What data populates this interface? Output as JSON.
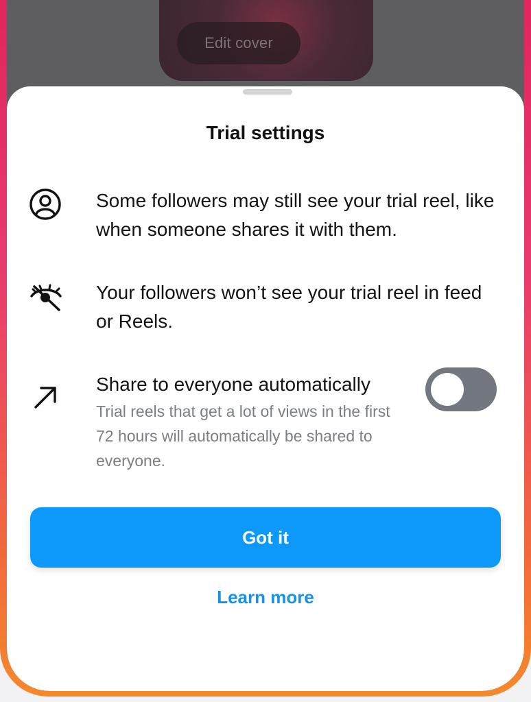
{
  "background": {
    "edit_cover_label": "Edit cover"
  },
  "sheet": {
    "title": "Trial settings",
    "rows": [
      {
        "icon": "person-circle-icon",
        "text": "Some followers may still see your trial reel, like when someone shares it with them."
      },
      {
        "icon": "eye-off-icon",
        "text": "Your followers won’t see your trial reel in feed or Reels."
      },
      {
        "icon": "arrow-up-right-icon",
        "title": "Share to everyone automatically",
        "description": "Trial reels that get a lot of views in the first 72 hours will automatically be shared to everyone.",
        "toggle_on": false
      }
    ],
    "primary_button": "Got it",
    "secondary_link": "Learn more"
  },
  "colors": {
    "primary_button": "#0d99fa",
    "link": "#1793e6",
    "toggle_off": "#727780",
    "frame_gradient_top": "#e0245e",
    "frame_gradient_bottom": "#f5892a"
  }
}
